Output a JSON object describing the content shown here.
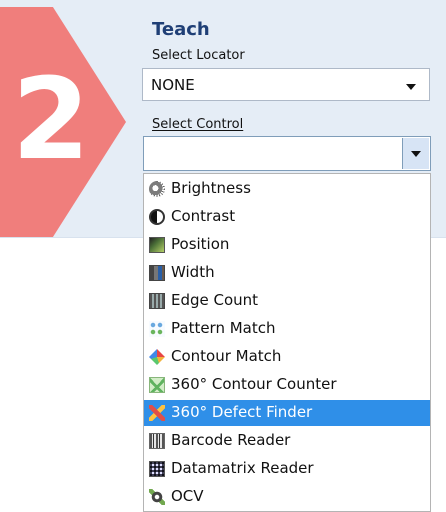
{
  "step": {
    "number": "2",
    "title": "Teach"
  },
  "locator": {
    "label": "Select Locator",
    "value": "NONE"
  },
  "control": {
    "label": "Select Control",
    "value": ""
  },
  "dropdown": {
    "items": [
      {
        "label": "Brightness",
        "icon": "brightness-icon"
      },
      {
        "label": "Contrast",
        "icon": "contrast-icon"
      },
      {
        "label": "Position",
        "icon": "position-icon"
      },
      {
        "label": "Width",
        "icon": "width-icon"
      },
      {
        "label": "Edge Count",
        "icon": "edge-count-icon"
      },
      {
        "label": "Pattern Match",
        "icon": "pattern-match-icon"
      },
      {
        "label": "Contour Match",
        "icon": "contour-match-icon"
      },
      {
        "label": "360° Contour Counter",
        "icon": "contour-counter-icon"
      },
      {
        "label": "360° Defect Finder",
        "icon": "defect-finder-icon",
        "selected": true
      },
      {
        "label": "Barcode Reader",
        "icon": "barcode-icon"
      },
      {
        "label": "Datamatrix Reader",
        "icon": "datamatrix-icon"
      },
      {
        "label": "OCV",
        "icon": "ocv-icon"
      }
    ]
  },
  "colors": {
    "panel_background": "#e5edf6",
    "step_accent": "#f07e7c",
    "title_text": "#1f3f76",
    "selection_highlight": "#2f8fe8"
  }
}
